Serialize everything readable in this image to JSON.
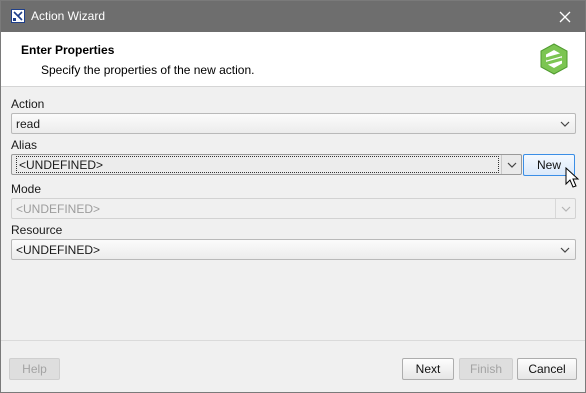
{
  "window": {
    "title": "Action Wizard",
    "close_icon": "close-icon",
    "app_icon": "wizard-app-icon"
  },
  "header": {
    "title": "Enter Properties",
    "subtitle": "Specify the properties of the  new action.",
    "logo_icon": "green-cube-logo-icon",
    "logo_color": "#6cc04a"
  },
  "form": {
    "action": {
      "label": "Action",
      "value": "read"
    },
    "alias": {
      "label": "Alias",
      "value": "<UNDEFINED>",
      "new_button": "New"
    },
    "mode": {
      "label": "Mode",
      "value": "<UNDEFINED>"
    },
    "resource": {
      "label": "Resource",
      "value": "<UNDEFINED>"
    }
  },
  "footer": {
    "help": "Help",
    "next": "Next",
    "finish": "Finish",
    "cancel": "Cancel"
  },
  "colors": {
    "titlebar": "#6e6e6e",
    "focus": "#3a8ee6"
  }
}
